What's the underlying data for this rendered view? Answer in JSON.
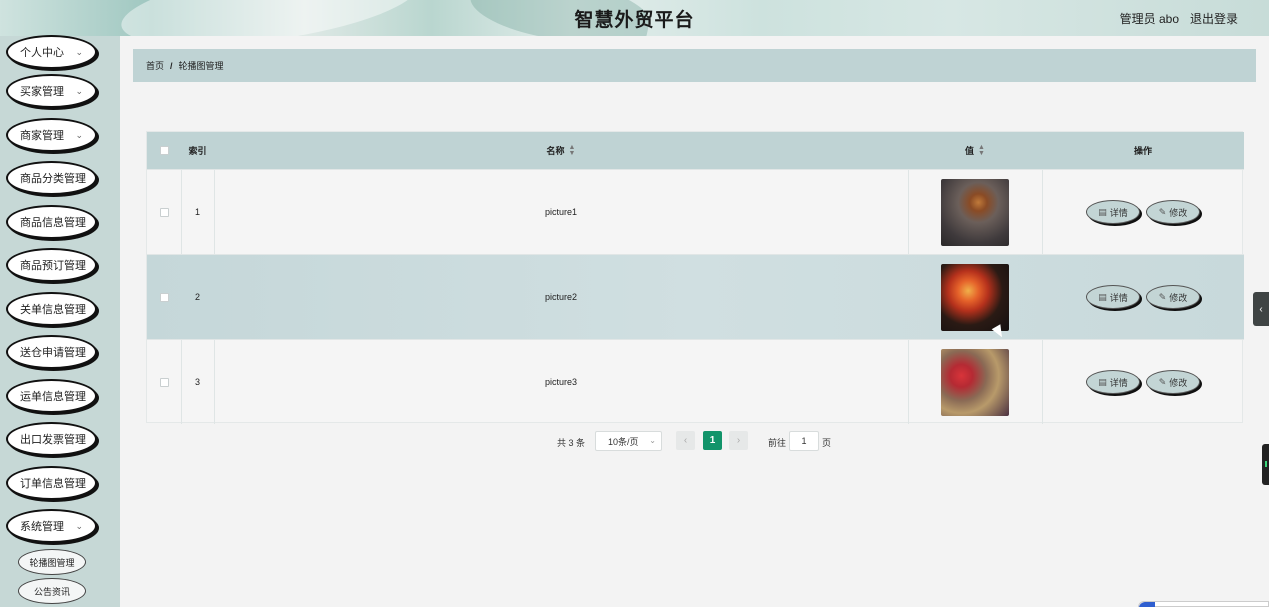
{
  "header": {
    "title": "智慧外贸平台",
    "user": "管理员 abo",
    "logout": "退出登录"
  },
  "sidebar": {
    "items": [
      {
        "label": "个人中心",
        "expandable": true
      },
      {
        "label": "买家管理",
        "expandable": true
      },
      {
        "label": "商家管理",
        "expandable": true
      },
      {
        "label": "商品分类管理",
        "expandable": false
      },
      {
        "label": "商品信息管理",
        "expandable": false
      },
      {
        "label": "商品预订管理",
        "expandable": false
      },
      {
        "label": "关单信息管理",
        "expandable": false
      },
      {
        "label": "送仓申请管理",
        "expandable": false
      },
      {
        "label": "运单信息管理",
        "expandable": false
      },
      {
        "label": "出口发票管理",
        "expandable": false
      },
      {
        "label": "订单信息管理",
        "expandable": false
      },
      {
        "label": "系统管理",
        "expandable": true
      }
    ],
    "sub_items": [
      "轮播图管理",
      "公告资讯"
    ]
  },
  "breadcrumb": {
    "home": "首页",
    "separator": "/",
    "current": "轮播图管理"
  },
  "table": {
    "headers": {
      "index": "索引",
      "name": "名称",
      "value": "值",
      "actions": "操作"
    },
    "rows": [
      {
        "index": "1",
        "name": "picture1",
        "thumb": "thumb1"
      },
      {
        "index": "2",
        "name": "picture2",
        "thumb": "thumb2"
      },
      {
        "index": "3",
        "name": "picture3",
        "thumb": "thumb3"
      }
    ],
    "detail_label": "详情",
    "edit_label": "修改"
  },
  "pagination": {
    "total": "共 3 条",
    "page_size": "10条/页",
    "current_page": "1",
    "goto_label": "前往",
    "goto_value": "1",
    "page_unit": "页"
  },
  "colors": {
    "accent": "#12946a",
    "sidebar_bg": "#c6d8d6",
    "header_row_bg": "#bfd3d4"
  }
}
